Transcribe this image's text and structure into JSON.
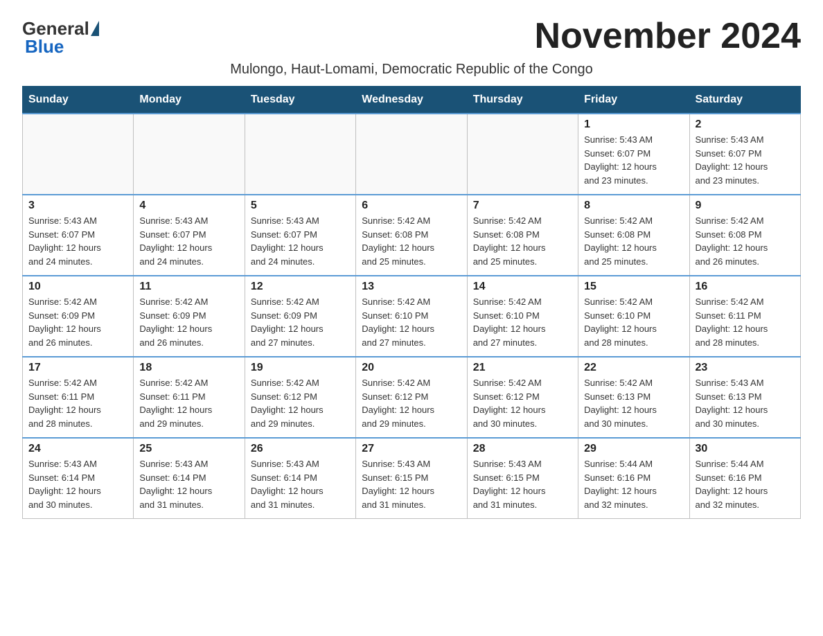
{
  "logo": {
    "general": "General",
    "blue": "Blue"
  },
  "title": "November 2024",
  "subtitle": "Mulongo, Haut-Lomami, Democratic Republic of the Congo",
  "days_header": [
    "Sunday",
    "Monday",
    "Tuesday",
    "Wednesday",
    "Thursday",
    "Friday",
    "Saturday"
  ],
  "weeks": [
    [
      {
        "day": "",
        "info": ""
      },
      {
        "day": "",
        "info": ""
      },
      {
        "day": "",
        "info": ""
      },
      {
        "day": "",
        "info": ""
      },
      {
        "day": "",
        "info": ""
      },
      {
        "day": "1",
        "info": "Sunrise: 5:43 AM\nSunset: 6:07 PM\nDaylight: 12 hours\nand 23 minutes."
      },
      {
        "day": "2",
        "info": "Sunrise: 5:43 AM\nSunset: 6:07 PM\nDaylight: 12 hours\nand 23 minutes."
      }
    ],
    [
      {
        "day": "3",
        "info": "Sunrise: 5:43 AM\nSunset: 6:07 PM\nDaylight: 12 hours\nand 24 minutes."
      },
      {
        "day": "4",
        "info": "Sunrise: 5:43 AM\nSunset: 6:07 PM\nDaylight: 12 hours\nand 24 minutes."
      },
      {
        "day": "5",
        "info": "Sunrise: 5:43 AM\nSunset: 6:07 PM\nDaylight: 12 hours\nand 24 minutes."
      },
      {
        "day": "6",
        "info": "Sunrise: 5:42 AM\nSunset: 6:08 PM\nDaylight: 12 hours\nand 25 minutes."
      },
      {
        "day": "7",
        "info": "Sunrise: 5:42 AM\nSunset: 6:08 PM\nDaylight: 12 hours\nand 25 minutes."
      },
      {
        "day": "8",
        "info": "Sunrise: 5:42 AM\nSunset: 6:08 PM\nDaylight: 12 hours\nand 25 minutes."
      },
      {
        "day": "9",
        "info": "Sunrise: 5:42 AM\nSunset: 6:08 PM\nDaylight: 12 hours\nand 26 minutes."
      }
    ],
    [
      {
        "day": "10",
        "info": "Sunrise: 5:42 AM\nSunset: 6:09 PM\nDaylight: 12 hours\nand 26 minutes."
      },
      {
        "day": "11",
        "info": "Sunrise: 5:42 AM\nSunset: 6:09 PM\nDaylight: 12 hours\nand 26 minutes."
      },
      {
        "day": "12",
        "info": "Sunrise: 5:42 AM\nSunset: 6:09 PM\nDaylight: 12 hours\nand 27 minutes."
      },
      {
        "day": "13",
        "info": "Sunrise: 5:42 AM\nSunset: 6:10 PM\nDaylight: 12 hours\nand 27 minutes."
      },
      {
        "day": "14",
        "info": "Sunrise: 5:42 AM\nSunset: 6:10 PM\nDaylight: 12 hours\nand 27 minutes."
      },
      {
        "day": "15",
        "info": "Sunrise: 5:42 AM\nSunset: 6:10 PM\nDaylight: 12 hours\nand 28 minutes."
      },
      {
        "day": "16",
        "info": "Sunrise: 5:42 AM\nSunset: 6:11 PM\nDaylight: 12 hours\nand 28 minutes."
      }
    ],
    [
      {
        "day": "17",
        "info": "Sunrise: 5:42 AM\nSunset: 6:11 PM\nDaylight: 12 hours\nand 28 minutes."
      },
      {
        "day": "18",
        "info": "Sunrise: 5:42 AM\nSunset: 6:11 PM\nDaylight: 12 hours\nand 29 minutes."
      },
      {
        "day": "19",
        "info": "Sunrise: 5:42 AM\nSunset: 6:12 PM\nDaylight: 12 hours\nand 29 minutes."
      },
      {
        "day": "20",
        "info": "Sunrise: 5:42 AM\nSunset: 6:12 PM\nDaylight: 12 hours\nand 29 minutes."
      },
      {
        "day": "21",
        "info": "Sunrise: 5:42 AM\nSunset: 6:12 PM\nDaylight: 12 hours\nand 30 minutes."
      },
      {
        "day": "22",
        "info": "Sunrise: 5:42 AM\nSunset: 6:13 PM\nDaylight: 12 hours\nand 30 minutes."
      },
      {
        "day": "23",
        "info": "Sunrise: 5:43 AM\nSunset: 6:13 PM\nDaylight: 12 hours\nand 30 minutes."
      }
    ],
    [
      {
        "day": "24",
        "info": "Sunrise: 5:43 AM\nSunset: 6:14 PM\nDaylight: 12 hours\nand 30 minutes."
      },
      {
        "day": "25",
        "info": "Sunrise: 5:43 AM\nSunset: 6:14 PM\nDaylight: 12 hours\nand 31 minutes."
      },
      {
        "day": "26",
        "info": "Sunrise: 5:43 AM\nSunset: 6:14 PM\nDaylight: 12 hours\nand 31 minutes."
      },
      {
        "day": "27",
        "info": "Sunrise: 5:43 AM\nSunset: 6:15 PM\nDaylight: 12 hours\nand 31 minutes."
      },
      {
        "day": "28",
        "info": "Sunrise: 5:43 AM\nSunset: 6:15 PM\nDaylight: 12 hours\nand 31 minutes."
      },
      {
        "day": "29",
        "info": "Sunrise: 5:44 AM\nSunset: 6:16 PM\nDaylight: 12 hours\nand 32 minutes."
      },
      {
        "day": "30",
        "info": "Sunrise: 5:44 AM\nSunset: 6:16 PM\nDaylight: 12 hours\nand 32 minutes."
      }
    ]
  ]
}
